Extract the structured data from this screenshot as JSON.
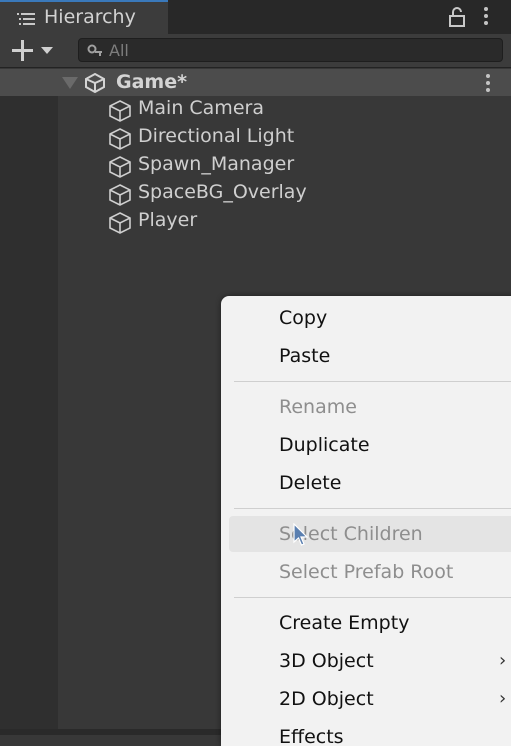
{
  "tab": {
    "title": "Hierarchy",
    "icon": "list-icon"
  },
  "toolbar": {
    "add_icon": "plus-icon",
    "search": {
      "placeholder": "All",
      "value": ""
    }
  },
  "scene": {
    "name": "Game*",
    "icon": "unity-logo-icon"
  },
  "objects": [
    {
      "label": "Main Camera",
      "icon": "cube-icon"
    },
    {
      "label": "Directional Light",
      "icon": "cube-icon"
    },
    {
      "label": "Spawn_Manager",
      "icon": "cube-icon"
    },
    {
      "label": "SpaceBG_Overlay",
      "icon": "cube-icon"
    },
    {
      "label": "Player",
      "icon": "cube-icon"
    }
  ],
  "context_menu": {
    "items": [
      {
        "label": "Copy",
        "enabled": true
      },
      {
        "label": "Paste",
        "enabled": true
      },
      {
        "label": "Rename",
        "enabled": false
      },
      {
        "label": "Duplicate",
        "enabled": true
      },
      {
        "label": "Delete",
        "enabled": true
      },
      {
        "label": "Select Children",
        "enabled": false,
        "hovered": true
      },
      {
        "label": "Select Prefab Root",
        "enabled": false
      },
      {
        "label": "Create Empty",
        "enabled": true
      },
      {
        "label": "3D Object",
        "enabled": true,
        "submenu": true
      },
      {
        "label": "2D Object",
        "enabled": true,
        "submenu": true
      },
      {
        "label": "Effects",
        "enabled": true
      }
    ]
  },
  "colors": {
    "accent": "#3a79bb",
    "panel_bg": "#383838",
    "menu_bg": "#f2f2f2"
  }
}
